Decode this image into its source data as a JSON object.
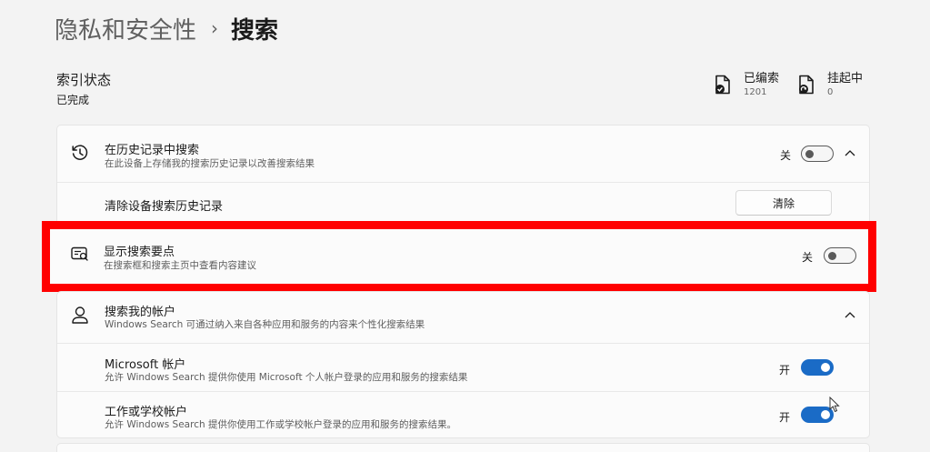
{
  "breadcrumb": {
    "parent": "隐私和安全性",
    "separator": "›",
    "current": "搜索"
  },
  "index_status": {
    "title": "索引状态",
    "value": "已完成",
    "indexed": {
      "label": "已编索",
      "count": "1201",
      "icon": "file-check-icon"
    },
    "pending": {
      "label": "挂起中",
      "count": "0",
      "icon": "file-pending-icon"
    }
  },
  "history": {
    "icon": "history-icon",
    "title": "在历史记录中搜索",
    "description": "在此设备上存储我的搜索历史记录以改善搜索结果",
    "toggle_label": "关",
    "toggle_on": false,
    "clear_row_title": "清除设备搜索历史记录",
    "clear_button": "清除"
  },
  "highlights": {
    "icon": "search-highlights-icon",
    "title": "显示搜索要点",
    "description": "在搜索框和搜索主页中查看内容建议",
    "toggle_label": "关",
    "toggle_on": false,
    "annotation_color": "#ff0000"
  },
  "account_search": {
    "icon": "person-icon",
    "title": "搜索我的帐户",
    "description": "Windows Search 可通过纳入来自各种应用和服务的内容来个性化搜索结果",
    "microsoft": {
      "title": "Microsoft 帐户",
      "description": "允许 Windows Search 提供你使用 Microsoft 个人帐户登录的应用和服务的搜索结果",
      "toggle_label": "开",
      "toggle_on": true
    },
    "work_school": {
      "title": "工作或学校帐户",
      "description": "允许 Windows Search 提供你使用工作或学校帐户登录的应用和服务的搜索结果。",
      "toggle_label": "开",
      "toggle_on": true
    }
  },
  "colors": {
    "accent": "#1a6bc6",
    "background": "#f3f3f3",
    "card": "#fbfbfb"
  }
}
